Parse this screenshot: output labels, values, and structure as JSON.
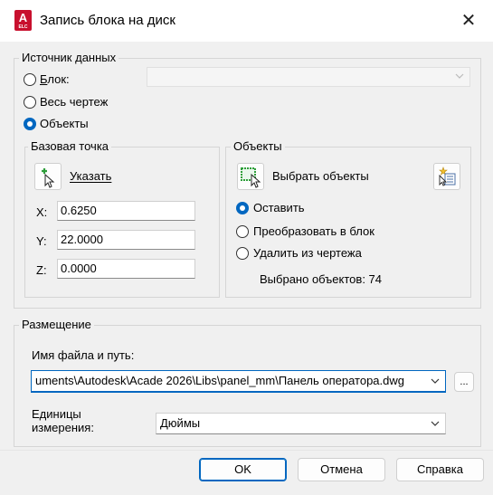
{
  "window": {
    "title": "Запись блока на диск",
    "app_icon_letter": "A",
    "app_icon_sub": "ELC",
    "close_glyph": "✕"
  },
  "source": {
    "legend": "Источник данных",
    "block_label": "Блок:",
    "whole_drawing_label": "Весь чертеж",
    "objects_label": "Объекты",
    "selected": "objects",
    "block_select_value": ""
  },
  "base_point": {
    "legend": "Базовая точка",
    "pick_label": "Указать",
    "x_label": "X:",
    "y_label": "Y:",
    "z_label": "Z:",
    "x_value": "0.6250",
    "y_value": "22.0000",
    "z_value": "0.0000"
  },
  "objects": {
    "legend": "Объекты",
    "select_label": "Выбрать объекты",
    "retain_label": "Оставить",
    "convert_label": "Преобразовать в блок",
    "delete_label": "Удалить из чертежа",
    "selected": "retain",
    "count_text": "Выбрано объектов: 74"
  },
  "placement": {
    "legend": "Размещение",
    "path_label": "Имя файла и путь:",
    "path_value": "uments\\Autodesk\\Acade 2026\\Libs\\panel_mm\\Панель оператора.dwg",
    "browse_label": "...",
    "units_label": "Единицы измерения:",
    "units_value": "Дюймы"
  },
  "buttons": {
    "ok": "OK",
    "cancel": "Отмена",
    "help": "Справка"
  },
  "colors": {
    "accent": "#0067c0",
    "app_icon": "#c8102e"
  }
}
